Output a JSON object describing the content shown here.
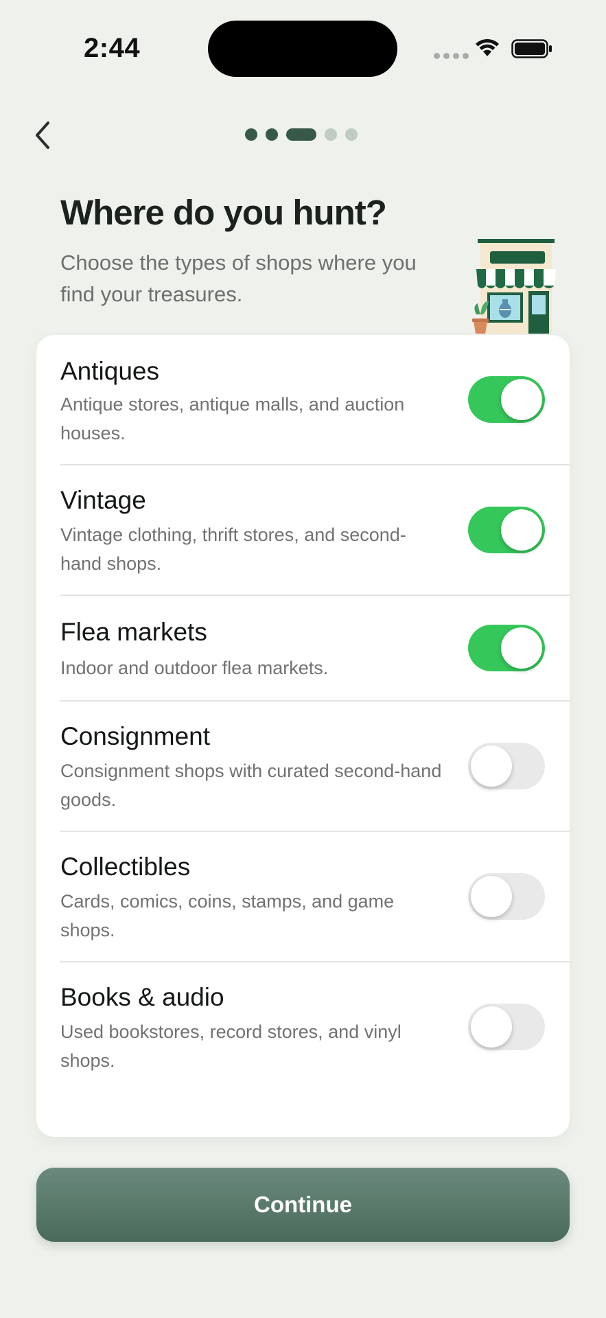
{
  "status_bar": {
    "time": "2:44"
  },
  "header": {
    "title": "Where do you hunt?",
    "subtitle": "Choose the types of shops where you find your treasures."
  },
  "progress": {
    "total_steps": 5,
    "current_step": 3
  },
  "shop_types": [
    {
      "title": "Antiques",
      "description": "Antique stores, antique malls, and auction houses.",
      "enabled": true
    },
    {
      "title": "Vintage",
      "description": "Vintage clothing, thrift stores, and second-hand shops.",
      "enabled": true
    },
    {
      "title": "Flea markets",
      "description": "Indoor and outdoor flea markets.",
      "enabled": true
    },
    {
      "title": "Consignment",
      "description": "Consignment shops with curated second-hand goods.",
      "enabled": false
    },
    {
      "title": "Collectibles",
      "description": "Cards, comics, coins, stamps, and game shops.",
      "enabled": false
    },
    {
      "title": "Books & audio",
      "description": "Used bookstores, record stores, and vinyl shops.",
      "enabled": false
    }
  ],
  "continue_label": "Continue",
  "colors": {
    "accent": "#35c75a",
    "brand_green": "#365a47",
    "button_gradient_top": "#6b8a7d",
    "button_gradient_bottom": "#4a6a5b",
    "background": "#eff1ec"
  },
  "icons": {
    "back": "chevron-left-icon",
    "illustration": "storefront-illustration"
  }
}
